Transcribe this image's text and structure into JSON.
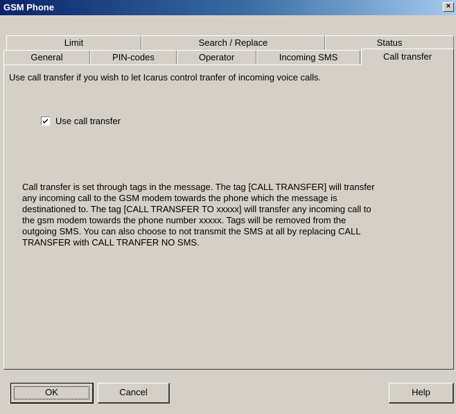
{
  "window": {
    "title": "GSM Phone",
    "close_glyph": "×"
  },
  "tabs_back": [
    {
      "label": "Limit"
    },
    {
      "label": "Search / Replace"
    },
    {
      "label": "Status"
    }
  ],
  "tabs_front": [
    {
      "label": "General"
    },
    {
      "label": "PIN-codes"
    },
    {
      "label": "Operator"
    },
    {
      "label": "Incoming SMS"
    },
    {
      "label": "Call transfer",
      "active": true
    }
  ],
  "panel": {
    "intro": "Use call transfer if you wish to let Icarus control tranfer of incoming voice calls.",
    "checkbox_label": "Use call transfer",
    "checkbox_checked": true,
    "description": "Call transfer is set through tags in the message. The tag [CALL TRANSFER] will transfer\nany incoming call to the GSM modem towards the phone which the message is\ndestinationed to. The tag [CALL TRANSFER TO xxxxx] will transfer any incoming call to\nthe gsm modem towards the phone number xxxxx. Tags will be removed from the\noutgoing SMS. You can also choose to not transmit the SMS at all by replacing CALL\nTRANSFER with CALL TRANFER NO SMS."
  },
  "buttons": {
    "ok": "OK",
    "cancel": "Cancel",
    "help": "Help"
  }
}
